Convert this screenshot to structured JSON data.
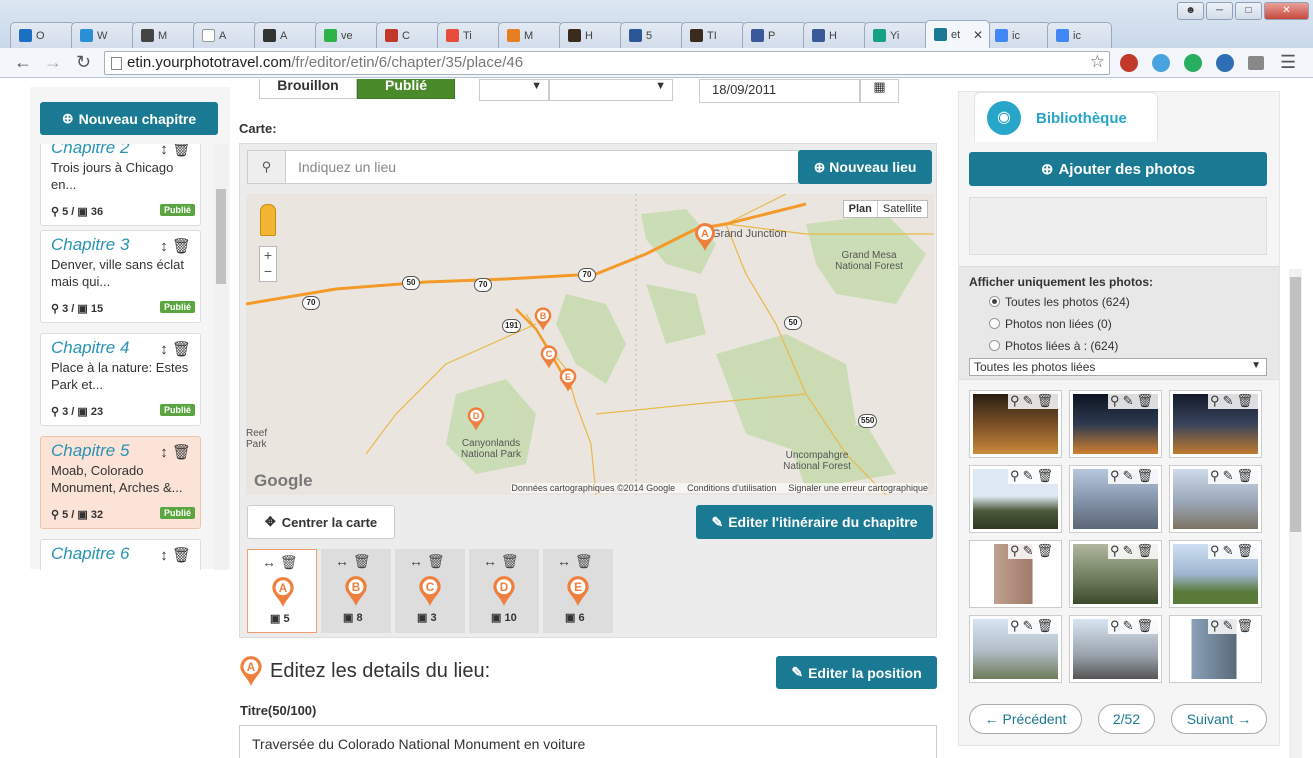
{
  "browser": {
    "tabs": [
      {
        "label": "O",
        "color": "#1d6fc4"
      },
      {
        "label": "W",
        "color": "#2b8fd6"
      },
      {
        "label": "M",
        "color": "#444444"
      },
      {
        "label": "A",
        "color": "#ffffff"
      },
      {
        "label": "A",
        "color": "#333333"
      },
      {
        "label": "ve",
        "color": "#2db34a"
      },
      {
        "label": "C",
        "color": "#c0392b"
      },
      {
        "label": "Ti",
        "color": "#e74c3c"
      },
      {
        "label": "M",
        "color": "#e67e22"
      },
      {
        "label": "H",
        "color": "#3a2b1e"
      },
      {
        "label": "5",
        "color": "#2b5797"
      },
      {
        "label": "TI",
        "color": "#3a2b1e"
      },
      {
        "label": "P",
        "color": "#3b5998"
      },
      {
        "label": "H",
        "color": "#3b5998"
      },
      {
        "label": "Yi",
        "color": "#16a085"
      },
      {
        "label": "et",
        "color": "#1b7a93",
        "active": true
      },
      {
        "label": "ic",
        "color": "#4285f4"
      },
      {
        "label": "ic",
        "color": "#4285f4"
      }
    ],
    "url_host": "etin.yourphototravel.com",
    "url_path": "/fr/editor/etin/6/chapter/35/place/46"
  },
  "sidebar": {
    "new_chapter_label": "Nouveau chapitre",
    "chapters": [
      {
        "title": "Chapitre 2",
        "desc": "Trois jours à Chicago en...",
        "places": "5 /",
        "photos": "36",
        "status": "Publié"
      },
      {
        "title": "Chapitre 3",
        "desc": "Denver, ville sans éclat mais qui...",
        "places": "3 /",
        "photos": "15",
        "status": "Publié"
      },
      {
        "title": "Chapitre 4",
        "desc": "Place à la nature: Estes Park et...",
        "places": "3 /",
        "photos": "23",
        "status": "Publié"
      },
      {
        "title": "Chapitre 5",
        "desc": "Moab, Colorado Monument, Arches &...",
        "places": "5 /",
        "photos": "32",
        "status": "Publié"
      },
      {
        "title": "Chapitre 6",
        "desc": "",
        "places": "",
        "photos": "",
        "status": ""
      }
    ]
  },
  "editor": {
    "draft_label": "Brouillon",
    "published_label": "Publié",
    "date_value": "18/09/2011",
    "map_label": "Carte:",
    "place_placeholder": "Indiquez un lieu",
    "new_place_label": "Nouveau lieu",
    "map_type_plan": "Plan",
    "map_type_satellite": "Satellite",
    "map_labels": {
      "grand_junction": "Grand Junction",
      "grand_mesa": "Grand Mesa National Forest",
      "canyonlands": "Canyonlands National Park",
      "uncompahgre": "Uncompahgre National Forest",
      "reef_park": "Reef Park"
    },
    "highways": [
      "50",
      "70",
      "70",
      "70",
      "191",
      "50",
      "550"
    ],
    "map_footer": {
      "data": "Données cartographiques ©2014 Google",
      "terms": "Conditions d'utilisation",
      "report": "Signaler une erreur cartographique"
    },
    "google_logo": "Google",
    "center_map_label": "Centrer la carte",
    "edit_itinerary_label": "Editer l'itinéraire du chapitre",
    "places": [
      {
        "letter": "A",
        "count": "5",
        "selected": true
      },
      {
        "letter": "B",
        "count": "8"
      },
      {
        "letter": "C",
        "count": "3"
      },
      {
        "letter": "D",
        "count": "10"
      },
      {
        "letter": "E",
        "count": "6"
      }
    ],
    "details_heading": "Editez les details du lieu:",
    "details_letter": "A",
    "edit_position_label": "Editer la position",
    "title_label": "Titre(50/100)",
    "title_value": "Traversée du Colorado National Monument en voiture"
  },
  "library": {
    "tab_label": "Bibliothèque",
    "add_photos_label": "Ajouter des photos",
    "filter_title": "Afficher uniquement les photos:",
    "radios": [
      {
        "label": "Toutes les photos (624)",
        "checked": true
      },
      {
        "label": "Photos non liées (0)",
        "checked": false
      },
      {
        "label": "Photos liées à : (624)",
        "checked": false
      }
    ],
    "select_value": "Toutes les photos liées",
    "prev_label": "← Précédent",
    "page_label": "2/52",
    "next_label": "Suivant →"
  },
  "colors": {
    "accent": "#1b7a93",
    "marker": "#ef7f3c",
    "published": "#5aa53f"
  }
}
